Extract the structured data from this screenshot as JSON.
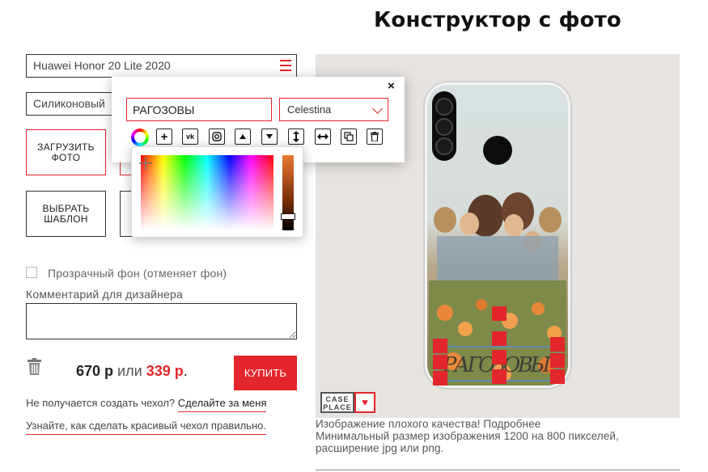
{
  "page_title": "Конструктор с фото",
  "model_select": {
    "value": "Huawei Honor 20 Lite 2020"
  },
  "material_select": {
    "value": "Силиконовый"
  },
  "buttons": {
    "upload_photo": "Загрузить фото",
    "choose_template": "Выбрать шаблон",
    "buy": "КУПИТЬ"
  },
  "transparent_bg": {
    "label": "Прозрачный фон (отменяет фон)",
    "checked": false
  },
  "comment": {
    "label": "Комментарий для дизайнера",
    "value": ""
  },
  "price": {
    "main": "670 р",
    "or": "или",
    "sale": "339 р",
    "dot": "."
  },
  "help": {
    "question": "Не получается создать чехол?",
    "do_for_me": "Сделайте за меня",
    "howto": "Узнайте, как сделать красивый чехол правильно."
  },
  "preview": {
    "caption_text": "РАГОЗОВЫ"
  },
  "logo": {
    "line1": "CASE",
    "line2": "PLACE",
    "heart": "♥"
  },
  "warning": {
    "line1": "Изображение плохого качества! Подробнее",
    "line2": "Минимальный размер изображения 1200 на 800 пикселей,",
    "line3": "расширение jpg или png."
  },
  "text_panel": {
    "close": "×",
    "input_value": "РАГОЗОВЫ",
    "font": "Celestina",
    "tools": [
      "color-wheel",
      "add",
      "vk",
      "instagram",
      "up",
      "down",
      "stretch-vertical",
      "stretch-horizontal",
      "copy",
      "delete"
    ]
  },
  "colors": {
    "accent": "#e3262b",
    "selected_color": "#000000"
  }
}
